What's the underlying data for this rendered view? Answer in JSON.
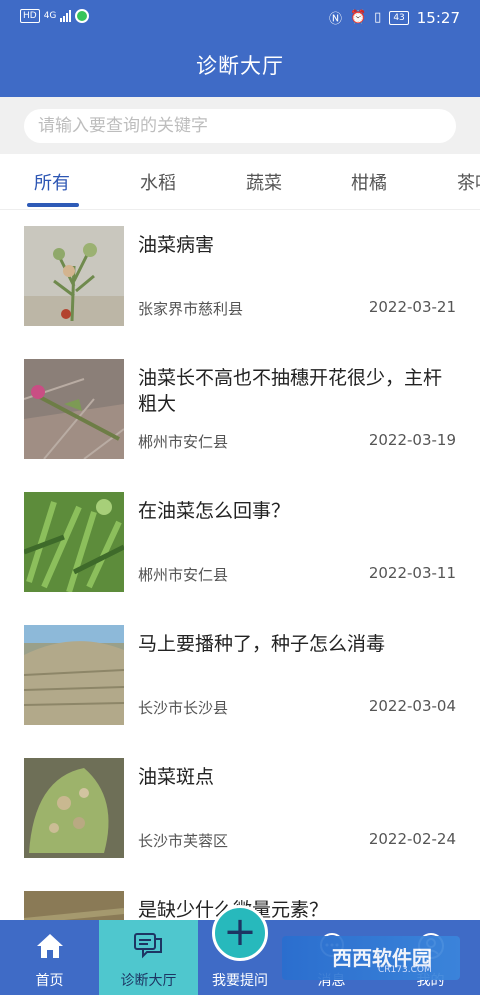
{
  "status_bar": {
    "hd": "HD",
    "network": "4G",
    "battery": "43",
    "time": "15:27"
  },
  "header": {
    "title": "诊断大厅"
  },
  "search": {
    "placeholder": "请输入要查询的关键字",
    "value": ""
  },
  "tabs": [
    {
      "label": "所有",
      "active": true
    },
    {
      "label": "水稻",
      "active": false
    },
    {
      "label": "蔬菜",
      "active": false
    },
    {
      "label": "柑橘",
      "active": false
    },
    {
      "label": "茶叶",
      "active": false
    }
  ],
  "posts": [
    {
      "title": "油菜病害",
      "location": "张家界市慈利县",
      "date": "2022-03-21",
      "thumb": "diseased-rapeseed-plant"
    },
    {
      "title": "油菜长不高也不抽穗开花很少，主杆粗大",
      "location": "郴州市安仁县",
      "date": "2022-03-19",
      "thumb": "rapeseed-stem-on-pavement"
    },
    {
      "title": "在油菜怎么回事？",
      "location": "郴州市安仁县",
      "date": "2022-03-11",
      "thumb": "green-rapeseed-leaves"
    },
    {
      "title": "马上要播种了，种子怎么消毒",
      "location": "长沙市长沙县",
      "date": "2022-03-04",
      "thumb": "seed-pile"
    },
    {
      "title": "油菜斑点",
      "location": "长沙市芙蓉区",
      "date": "2022-02-24",
      "thumb": "spotted-rapeseed-leaf"
    },
    {
      "title": "是缺少什么微量元素？",
      "location": "",
      "date": "",
      "thumb": "partial-plant-photo"
    }
  ],
  "bottom_nav": {
    "home": {
      "label": "首页",
      "icon": "home-icon"
    },
    "hall": {
      "label": "诊断大厅",
      "icon": "chat-icon",
      "active": true
    },
    "ask": {
      "label": "我要提问",
      "icon": "plus-icon"
    },
    "messages": {
      "label": "消息",
      "icon": "message-icon"
    },
    "mine": {
      "label": "我的",
      "icon": "user-icon"
    }
  },
  "watermark": {
    "text": "西西软件园",
    "sub": "CR173.COM"
  },
  "colors": {
    "primary": "#3f6bc6",
    "active_tab": "#2c55b3",
    "nav_active": "#4fc7ce",
    "fab": "#27b9bc"
  }
}
